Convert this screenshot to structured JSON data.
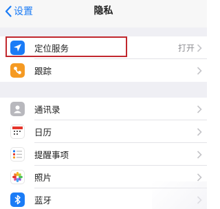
{
  "navbar": {
    "back_label": "设置",
    "title": "隐私"
  },
  "groups": [
    {
      "items": [
        {
          "label": "定位服务",
          "value": "打开",
          "icon": "location-arrow-icon",
          "icon_color": "#1b7cf6"
        },
        {
          "label": "跟踪",
          "value": "",
          "icon": "tracking-icon",
          "icon_color": "#f59a23"
        }
      ]
    },
    {
      "items": [
        {
          "label": "通讯录",
          "value": "",
          "icon": "contacts-icon",
          "icon_color": "#b8b8bd"
        },
        {
          "label": "日历",
          "value": "",
          "icon": "calendar-icon",
          "icon_color": "#ffffff"
        },
        {
          "label": "提醒事项",
          "value": "",
          "icon": "reminders-icon",
          "icon_color": "#ffffff"
        },
        {
          "label": "照片",
          "value": "",
          "icon": "photos-icon",
          "icon_color": "#ffffff"
        },
        {
          "label": "蓝牙",
          "value": "",
          "icon": "bluetooth-icon",
          "icon_color": "#1b7cf6"
        }
      ]
    }
  ],
  "colors": {
    "accent": "#1b7cf6",
    "highlight_border": "#c1272d"
  }
}
